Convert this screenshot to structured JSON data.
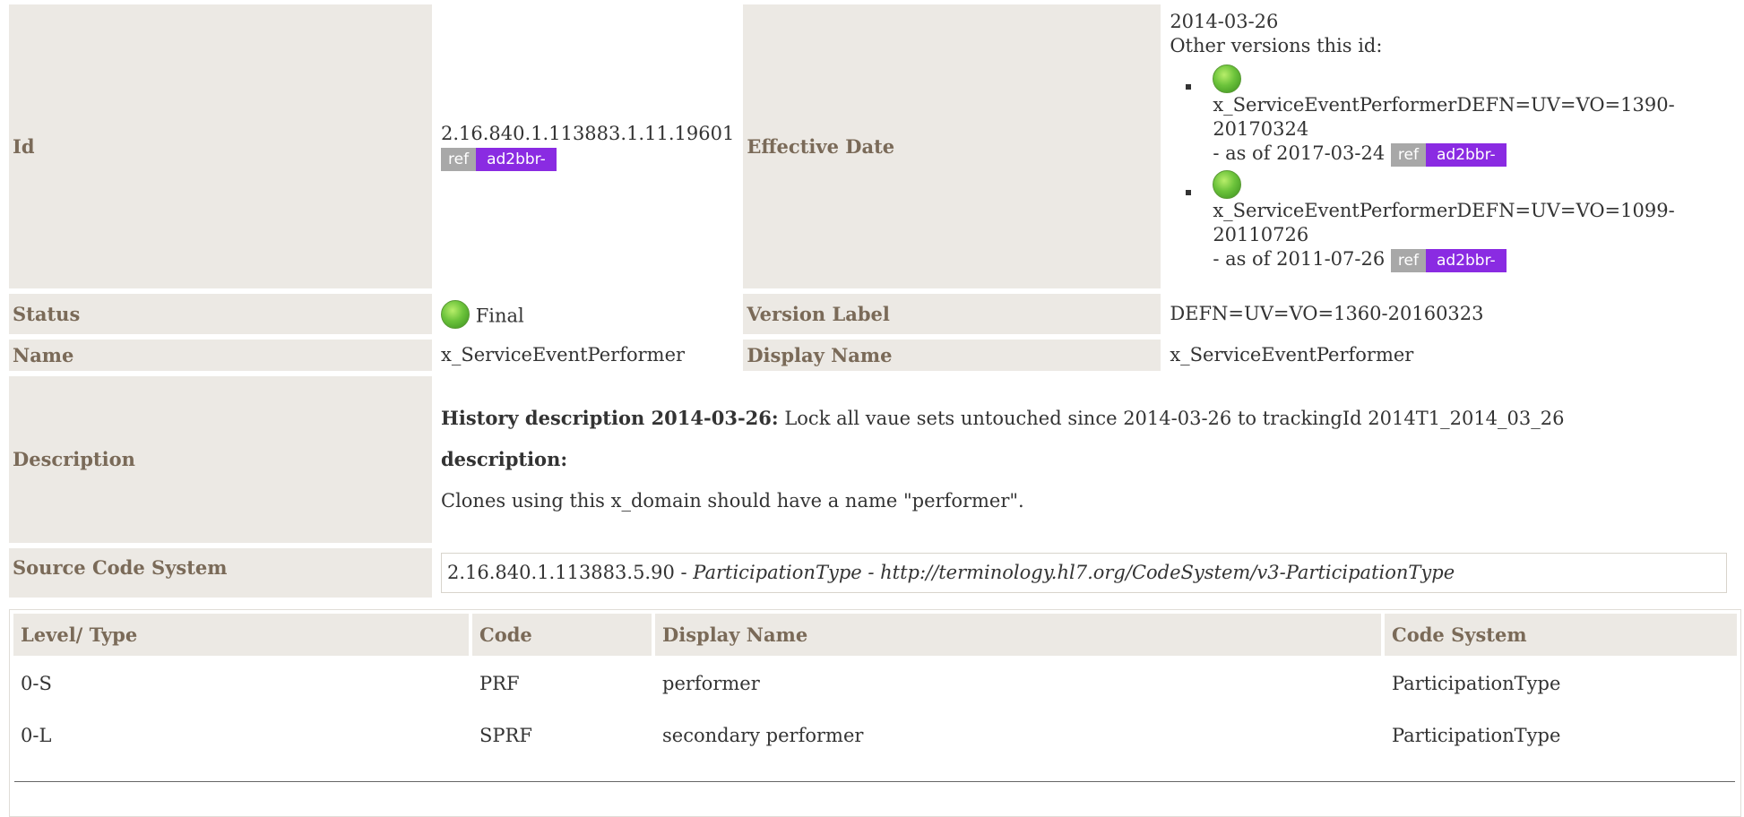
{
  "meta": {
    "id_label": "Id",
    "id_value": "2.16.840.1.113883.1.11.19601",
    "id_ref": "ref",
    "id_project": "ad2bbr-",
    "effective_date_label": "Effective Date",
    "effective_date_value": "2014-03-26",
    "other_versions_label": "Other versions this id:",
    "other_versions": [
      {
        "name": "x_ServiceEventPerformerDEFN=UV=VO=1390-20170324",
        "as_of": "- as of 2017-03-24",
        "ref": "ref",
        "project": "ad2bbr-"
      },
      {
        "name": "x_ServiceEventPerformerDEFN=UV=VO=1099-20110726",
        "as_of": "- as of 2011-07-26",
        "ref": "ref",
        "project": "ad2bbr-"
      }
    ],
    "status_label": "Status",
    "status_value": "Final",
    "version_label_label": "Version Label",
    "version_label_value": "DEFN=UV=VO=1360-20160323",
    "name_label": "Name",
    "name_value": "x_ServiceEventPerformer",
    "display_name_label": "Display Name",
    "display_name_value": "x_ServiceEventPerformer",
    "description_label": "Description",
    "history_heading": "History description 2014-03-26:",
    "history_text": "Lock all vaue sets untouched since 2014-03-26 to trackingId 2014T1_2014_03_26",
    "description_heading": "description:",
    "description_text": "Clones using this x_domain should have a name \"performer\".",
    "source_label": "Source Code System",
    "source_oid": "2.16.840.1.113883.5.90 - ",
    "source_name": "ParticipationType",
    "source_sep": " - ",
    "source_url": "http://terminology.hl7.org/CodeSystem/v3-ParticipationType"
  },
  "concepts": {
    "headers": {
      "level": "Level/ Type",
      "code": "Code",
      "display": "Display Name",
      "system": "Code System"
    },
    "rows": [
      {
        "level": "0-S",
        "code": "PRF",
        "display": "performer",
        "system": "ParticipationType"
      },
      {
        "level": "0-L",
        "code": "SPRF",
        "display": "secondary performer",
        "system": "ParticipationType"
      }
    ]
  },
  "colors": {
    "label_bg": "#ece9e4",
    "label_text": "#7a6a58",
    "project_tag": "#8a2be2",
    "ref_tag": "#a8a8a8",
    "status_final": "#6cc33b"
  }
}
